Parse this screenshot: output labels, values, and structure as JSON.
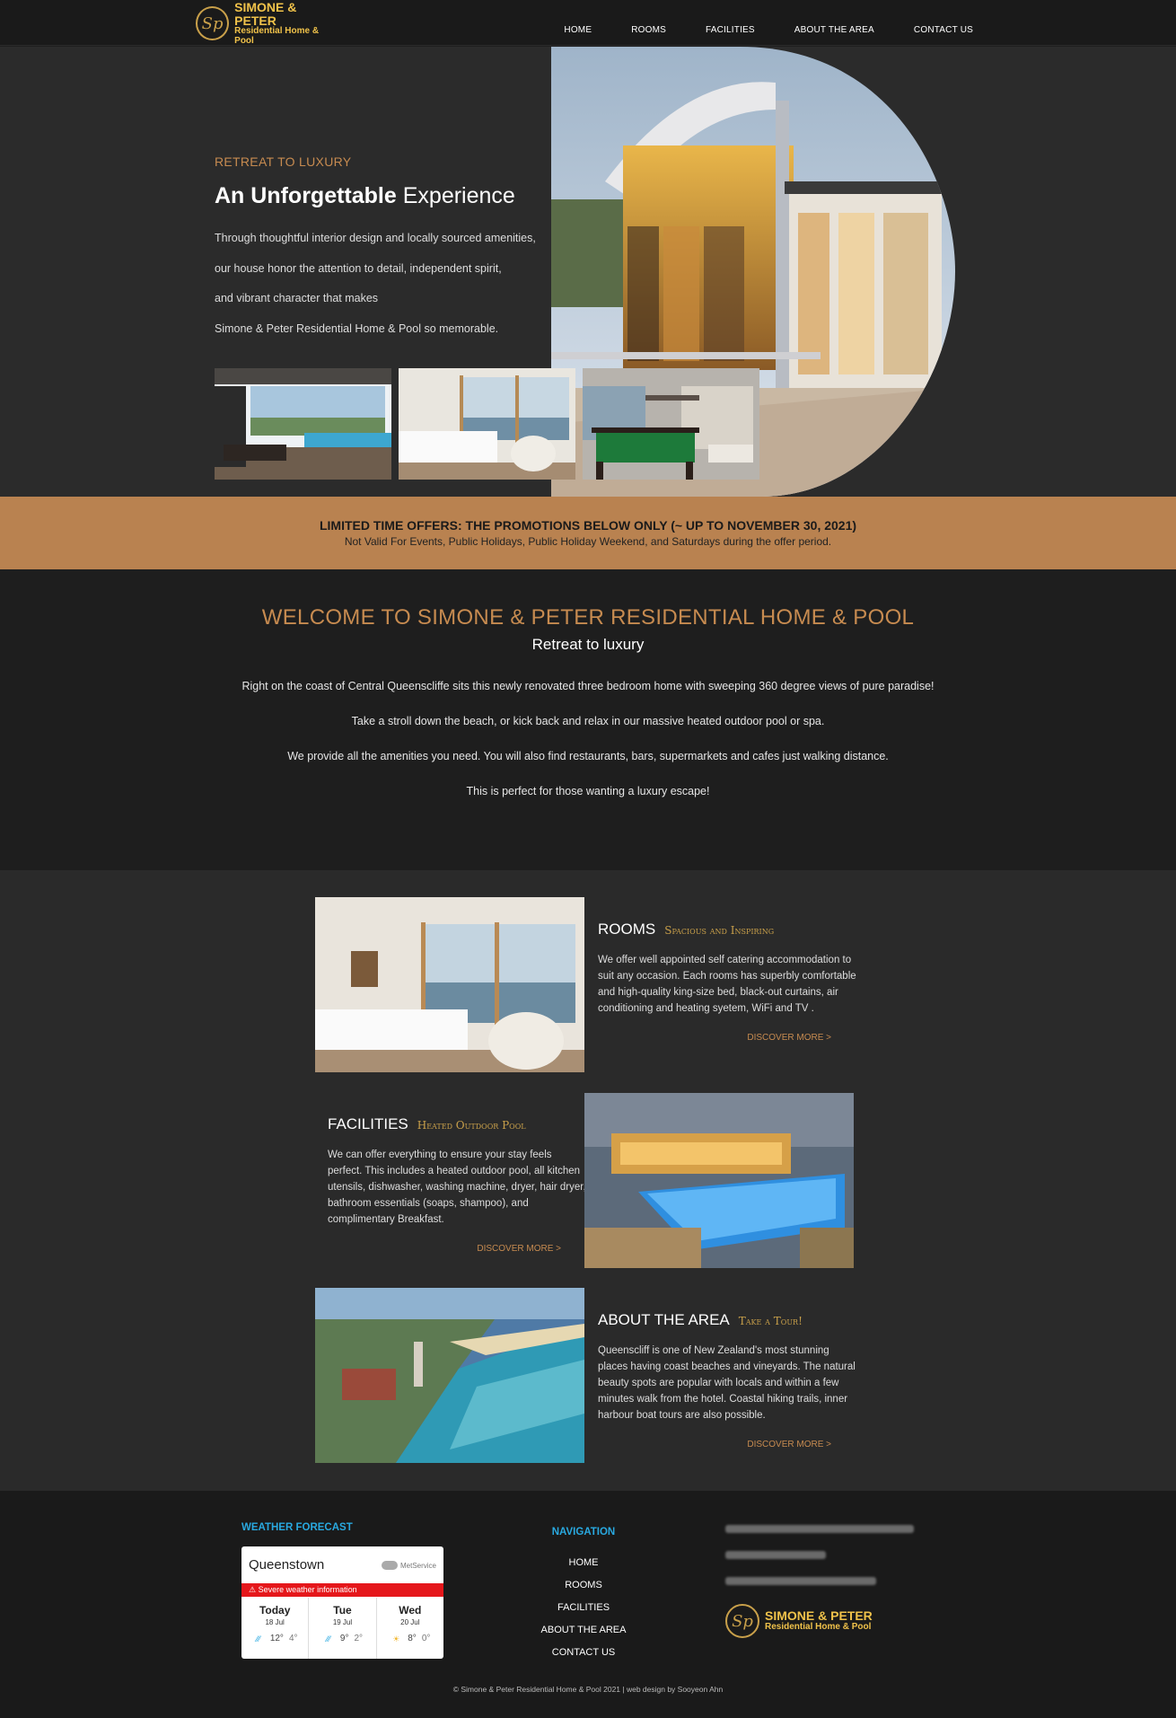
{
  "brand": {
    "monogram": "Sp",
    "name_line1": "SIMONE & PETER",
    "name_line2": "Residential Home & Pool"
  },
  "nav": [
    "HOME",
    "ROOMS",
    "FACILITIES",
    "ABOUT THE AREA",
    "CONTACT US"
  ],
  "hero": {
    "eyebrow": "RETREAT TO LUXURY",
    "title_bold": "An Unforgettable",
    "title_light": "Experience",
    "lines": [
      "Through thoughtful interior design and locally sourced amenities,",
      "our house honor the attention to detail, independent spirit,",
      "and vibrant character that makes",
      "Simone & Peter Residential Home & Pool so memorable."
    ]
  },
  "promo": {
    "headline": "LIMITED TIME OFFERS: THE PROMOTIONS BELOW ONLY (~ UP TO NOVEMBER 30, 2021)",
    "note": "Not Valid For Events, Public Holidays, Public Holiday Weekend, and Saturdays during the offer period."
  },
  "welcome": {
    "title": "WELCOME TO SIMONE & PETER RESIDENTIAL HOME & POOL",
    "subtitle": "Retreat to luxury",
    "paragraphs": [
      "Right on the coast of Central Queenscliffe sits this newly renovated three bedroom home with sweeping 360 degree views of pure paradise!",
      "Take a stroll down the beach, or kick back and relax in our massive heated outdoor pool or spa.",
      "We provide all the amenities you need. You will also find restaurants, bars, supermarkets and cafes just walking distance.",
      "This is perfect for those wanting a luxury escape!"
    ]
  },
  "features": [
    {
      "title": "ROOMS",
      "subtitle": "Spacious and Inspiring",
      "text": "We offer well appointed self catering accommodation to suit any occasion. Each rooms has superbly comfortable and high-quality king-size bed, black-out curtains, air conditioning and heating syetem, WiFi and TV .",
      "link": "DISCOVER MORE >"
    },
    {
      "title": "FACILITIES",
      "subtitle": "Heated Outdoor Pool",
      "text": "We can offer everything to ensure your stay feels perfect. This includes a heated outdoor pool, all kitchen utensils, dishwasher, washing machine, dryer, hair dryer, bathroom essentials (soaps, shampoo), and complimentary Breakfast.",
      "link": "DISCOVER MORE >"
    },
    {
      "title": "ABOUT THE AREA",
      "subtitle": "Take a Tour!",
      "text": "Queenscliff is one of New Zealand's most stunning places having coast beaches and vineyards. The natural beauty spots are popular with locals and within a few minutes walk from the hotel. Coastal hiking trails, inner harbour boat tours are also possible.",
      "link": "DISCOVER MORE >"
    }
  ],
  "footer": {
    "weather_title": "WEATHER FORECAST",
    "weather": {
      "city": "Queenstown",
      "provider": "MetService",
      "alert": "Severe weather information",
      "days": [
        {
          "name": "Today",
          "date": "18 Jul",
          "high": "12°",
          "low": "4°"
        },
        {
          "name": "Tue",
          "date": "19 Jul",
          "high": "9°",
          "low": "2°"
        },
        {
          "name": "Wed",
          "date": "20 Jul",
          "high": "8°",
          "low": "0°"
        }
      ]
    },
    "nav_title": "NAVIGATION",
    "nav": [
      "HOME",
      "ROOMS",
      "FACILITIES",
      "ABOUT THE AREA",
      "CONTACT US"
    ],
    "copyright": "© Simone & Peter Residential Home & Pool 2021 | web design by Sooyeon Ahn"
  },
  "colors": {
    "accent": "#c78b50",
    "promo_bg": "#b98250",
    "gold": "#f0c24a",
    "footer_heading": "#29a9e0",
    "alert": "#e5171b"
  }
}
